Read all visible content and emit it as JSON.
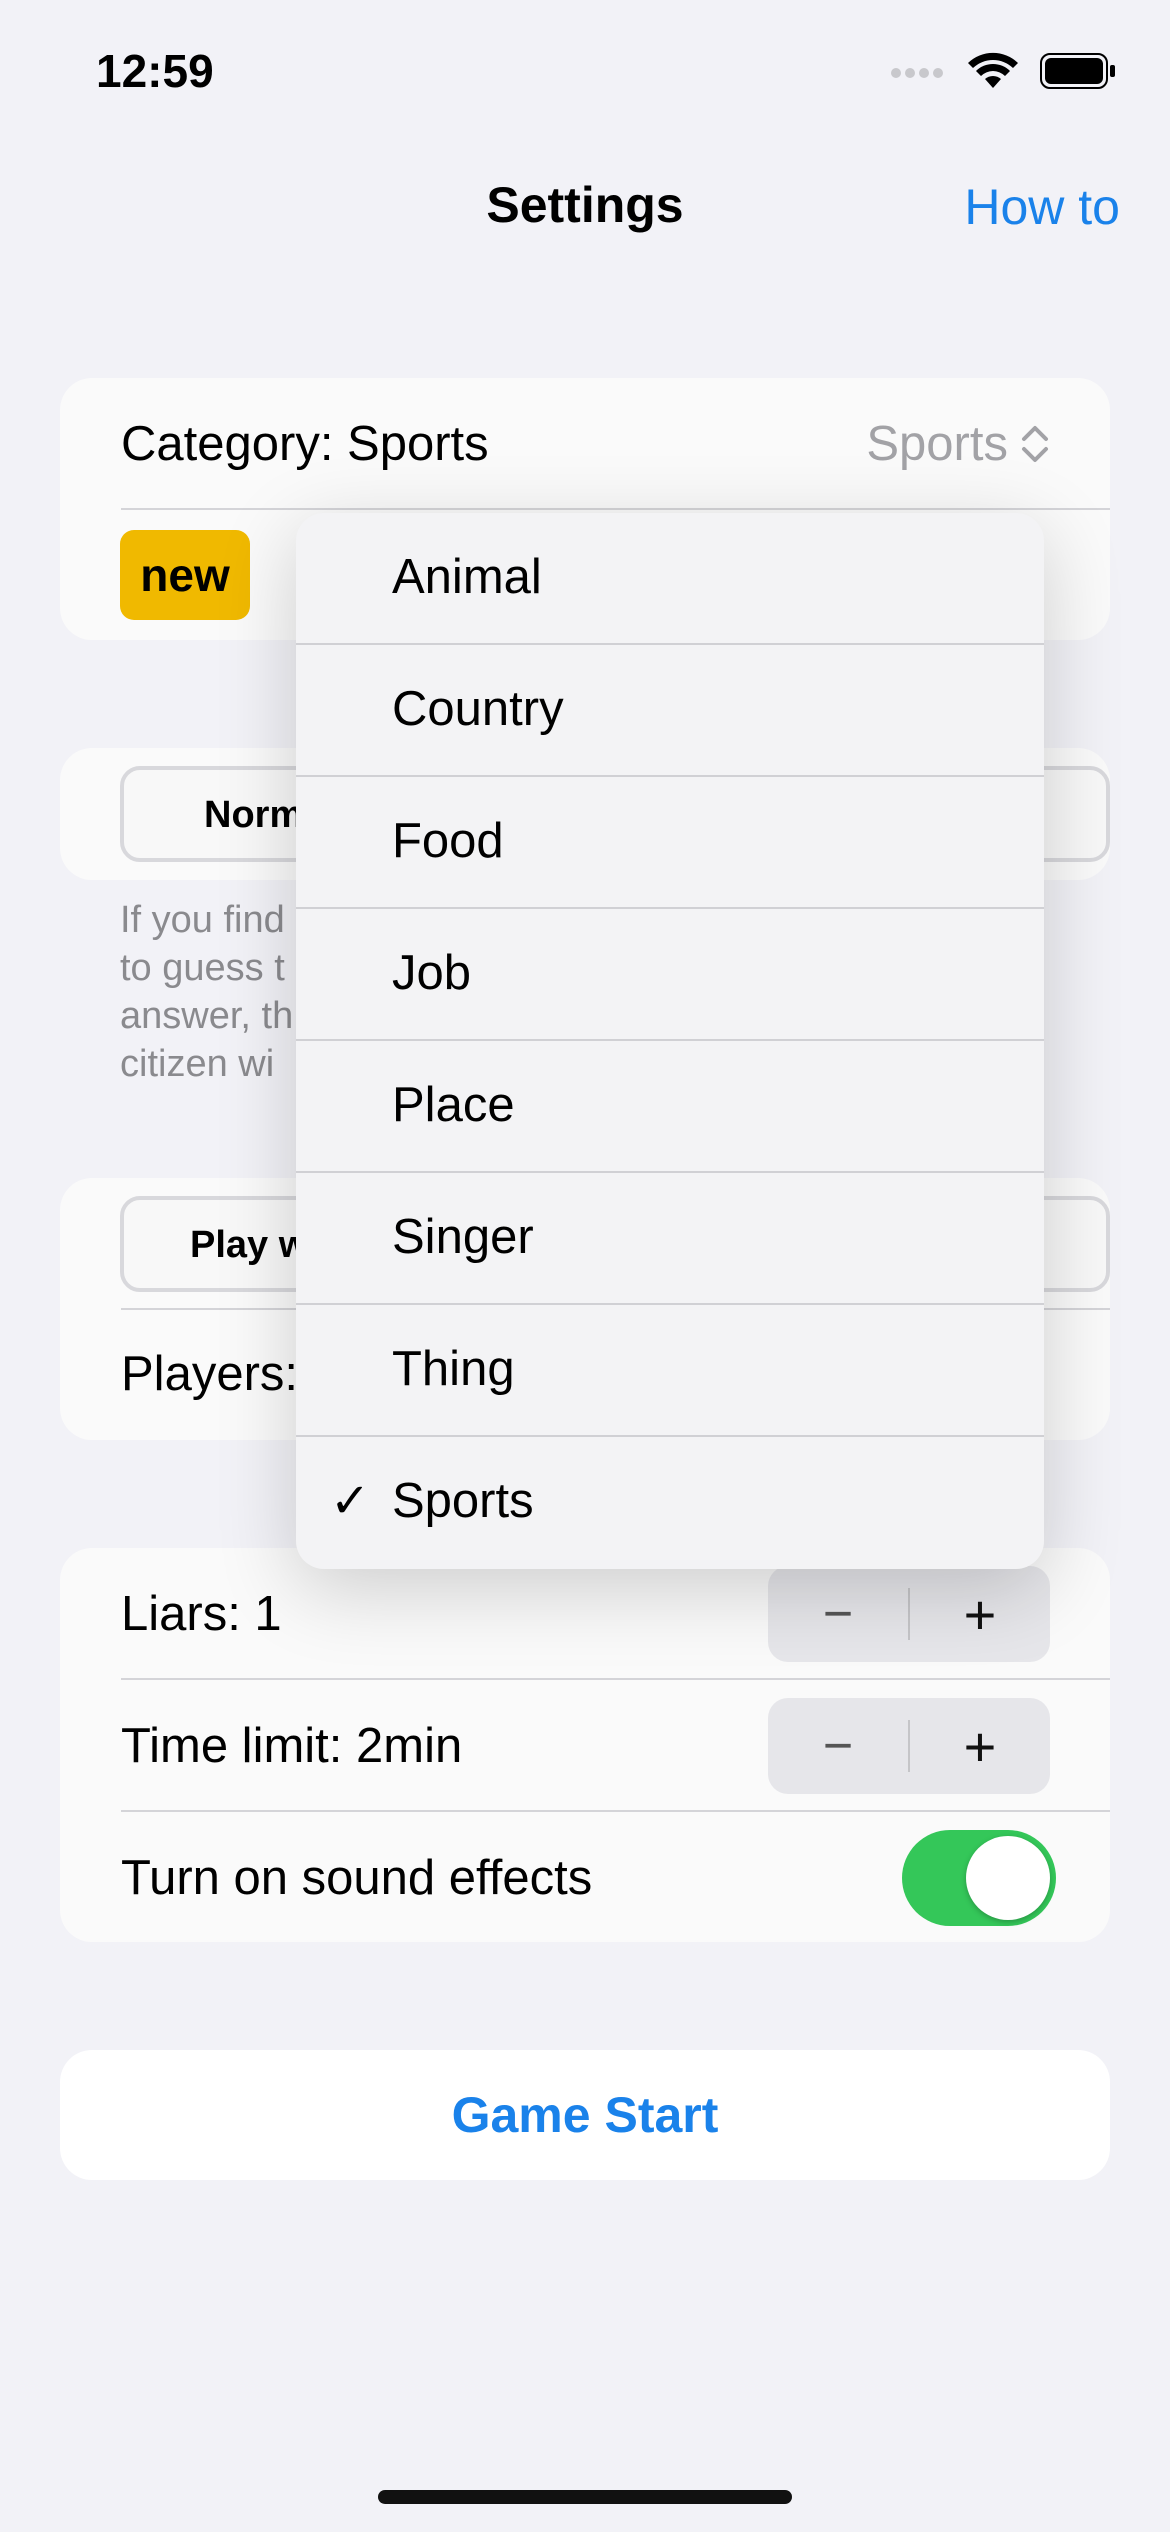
{
  "status": {
    "time": "12:59"
  },
  "nav": {
    "title": "Settings",
    "right_button": "How to"
  },
  "category": {
    "label": "Category: Sports",
    "selected": "Sports",
    "new_badge": "new",
    "menu": [
      {
        "label": "Animal",
        "checked": false
      },
      {
        "label": "Country",
        "checked": false
      },
      {
        "label": "Food",
        "checked": false
      },
      {
        "label": "Job",
        "checked": false
      },
      {
        "label": "Place",
        "checked": false
      },
      {
        "label": "Singer",
        "checked": false
      },
      {
        "label": "Thing",
        "checked": false
      },
      {
        "label": "Sports",
        "checked": true
      }
    ],
    "check_glyph": "✓"
  },
  "mode": {
    "segment_visible": "Norm",
    "hint_lines": [
      "If you find",
      "to guess t",
      "answer, th",
      "citizen wi"
    ]
  },
  "players": {
    "segment_visible": "Play w",
    "label_visible": "Players:"
  },
  "liars": {
    "label": "Liars: 1"
  },
  "time_limit": {
    "label": "Time limit: 2min"
  },
  "sound": {
    "label": "Turn on sound effects",
    "on": true
  },
  "stepper": {
    "minus": "−",
    "plus": "+"
  },
  "game_start": {
    "label": "Game Start"
  },
  "colors": {
    "accent": "#1a82ea",
    "toggle_on": "#34c759",
    "badge": "#f0b900"
  }
}
